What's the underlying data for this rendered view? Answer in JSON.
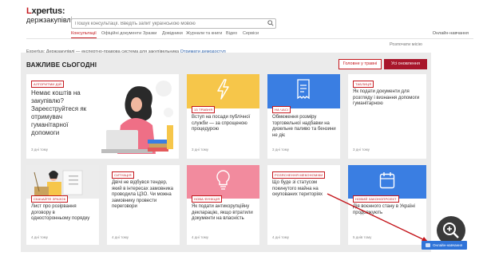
{
  "logo": {
    "brand_a": "L",
    "brand_b": "xpertus:",
    "brand_sub": "держзакупівлі"
  },
  "search": {
    "placeholder": "Пошук консультації. Введіть запит українською мовою"
  },
  "nav": {
    "items": [
      "Консультації",
      "Офіційні документи",
      "Зразки",
      "Довідники",
      "Журнали та книги",
      "Відео",
      "Сервіси"
    ],
    "right": "Онлайн-навчання"
  },
  "subheader": {
    "text": "Expertus: Держзакупівлі — експертно-правова система для закупівельника",
    "link": "Отримати демодоступ",
    "right": "Розпочати місію"
  },
  "panel": {
    "title": "ВАЖЛИВЕ СЬОГОДНІ",
    "btn_main": "Головне у травні",
    "btn_all": "Усі оновлення"
  },
  "cards": [
    {
      "tag": "АЛГОРИТМИ ДІЙ",
      "text": "Немає коштів на закупівлю? Зареєструйтеся як отримувач гуманітарної допомоги",
      "time": "3 дні тому"
    },
    {
      "tag": "13 ТРАВНЯ",
      "text": "Вступ на посади публічної служби — за спрощеною процедурою",
      "time": "3 дні тому"
    },
    {
      "tag": "НА ЧАСІ",
      "text": "Обмеження розміру торговельної надбавки на дизельне паливо та бензини не діє",
      "time": "3 дні тому"
    },
    {
      "tag": "ТАБЛИЦЯ",
      "text": "Як подати документи для розгляду і визнання допомоги гуманітарною",
      "time": "3 дні тому"
    },
    {
      "tag": "СКАЧАЙТЕ ЗРАЗОК",
      "text": "Лист про розірвання договору в односторонньому порядку",
      "time": "4 дні тому"
    },
    {
      "tag": "СИТУАЦІЯ",
      "text": "Двічі не відбувся тендер, який в інтересах замовника проводила ЦЗО. Чи можна замовнику провести переговори",
      "time": "4 дні тому"
    },
    {
      "tag": "НОВА ФУНКЦІЯ",
      "text": "Як подати антикорупційну декларацію, якщо втратили документи на власність",
      "time": "4 дні тому"
    },
    {
      "tag": "РОЗЯСНЕННЯ МЕКОНОМІКИ",
      "text": "Що буде зі статусом покинутого майна на окупованих територіях",
      "time": "4 дні тому"
    },
    {
      "tag": "НОВИЙ ЗАКОНОПРОЕКТ",
      "text": "Дія воєнного стану в Україні продовжують",
      "time": "5 днів тому"
    }
  ],
  "chat": {
    "label": "Онлайн-навчання"
  },
  "colors": {
    "brand": "#c4161c",
    "yellow": "#f6c64a",
    "blue": "#3a7ee2",
    "pink": "#f28b9e",
    "panel_bg": "#ebebeb"
  },
  "icons": [
    "search-icon",
    "lightning-icon",
    "receipt-icon",
    "document-icon",
    "lightbulb-icon",
    "calendar-icon",
    "zoom-in-icon",
    "chat-icon"
  ]
}
